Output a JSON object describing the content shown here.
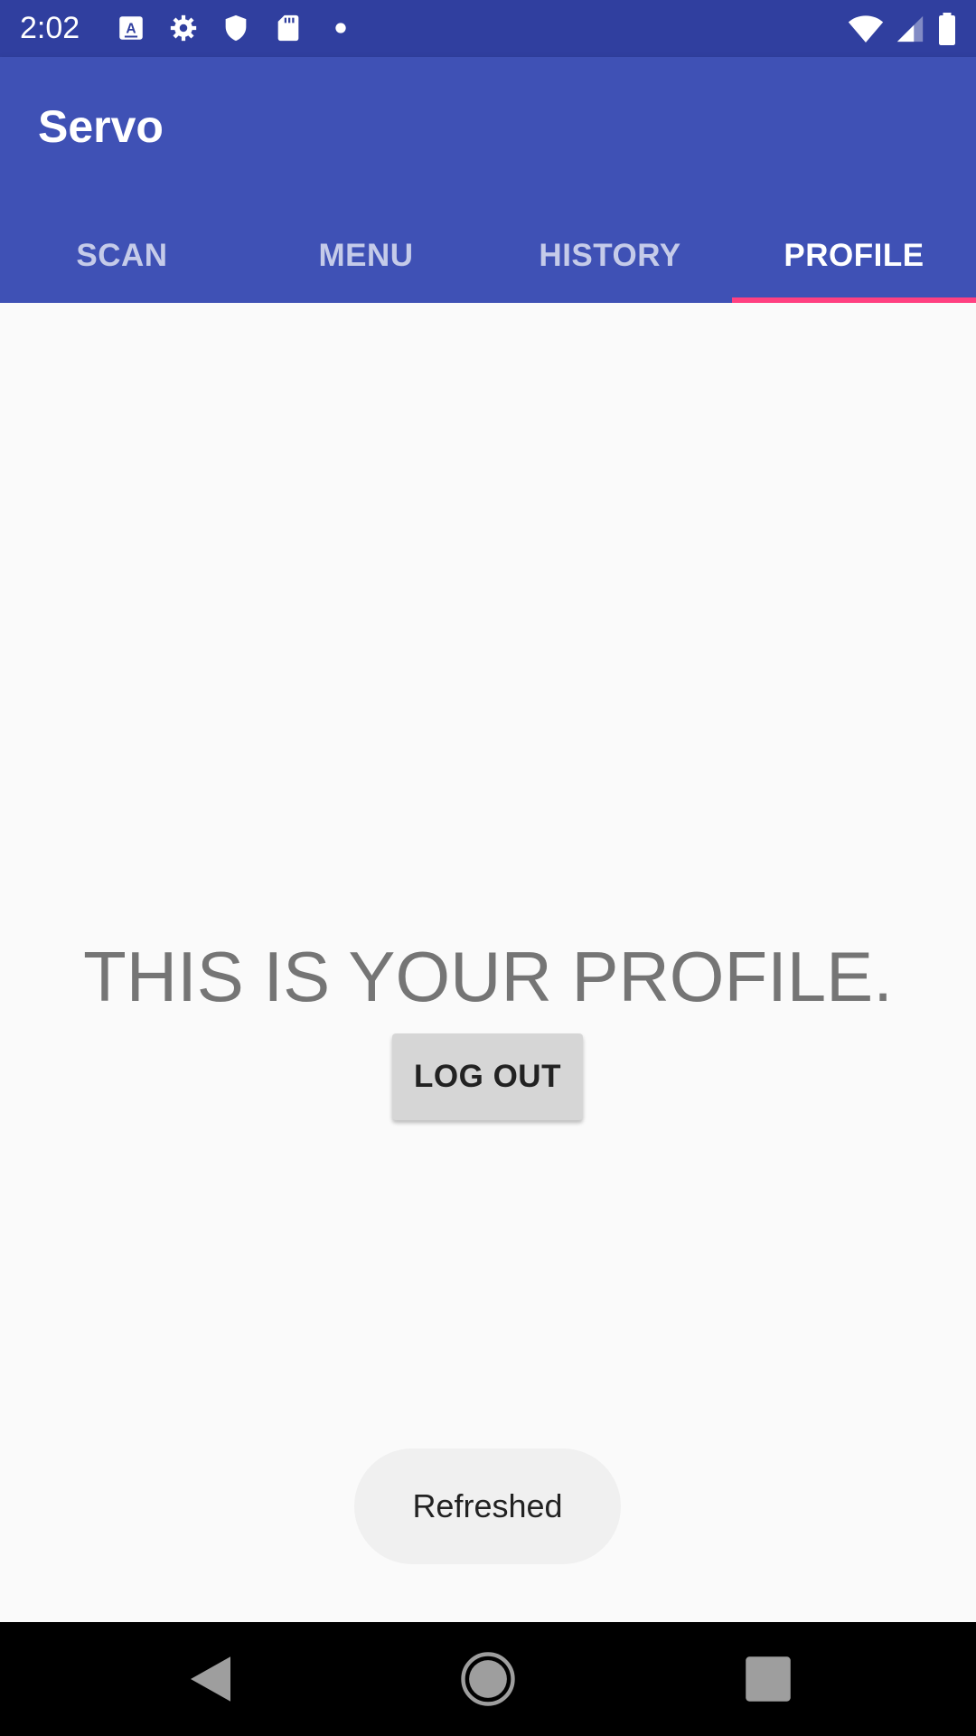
{
  "status_bar": {
    "time": "2:02",
    "left_icons": [
      "keyboard-a-icon",
      "settings-icon",
      "shield-icon",
      "sd-card-icon",
      "dot-icon"
    ],
    "right_icons": [
      "wifi-icon",
      "cell-signal-icon",
      "battery-icon"
    ]
  },
  "app_bar": {
    "title": "Servo",
    "color": "#3f51b5",
    "tabs": [
      {
        "label": "SCAN",
        "active": false
      },
      {
        "label": "MENU",
        "active": false
      },
      {
        "label": "HISTORY",
        "active": false
      },
      {
        "label": "PROFILE",
        "active": true
      }
    ],
    "indicator_color": "#ff4081"
  },
  "main": {
    "headline": "THIS IS YOUR PROFILE.",
    "logout_label": "LOG OUT"
  },
  "toast": {
    "message": "Refreshed"
  },
  "nav_bar": {
    "buttons": [
      "back-icon",
      "home-icon",
      "recents-icon"
    ]
  }
}
